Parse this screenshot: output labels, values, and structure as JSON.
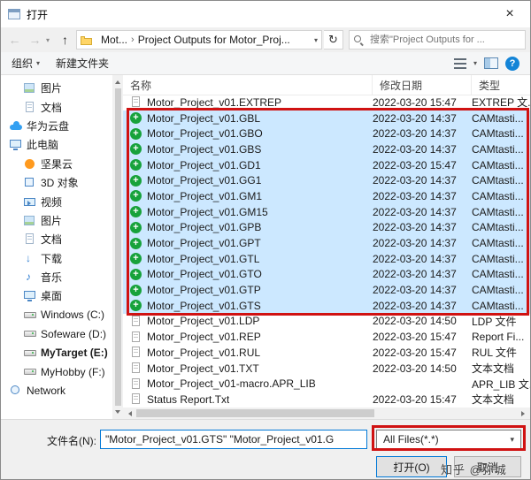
{
  "window": {
    "title": "打开"
  },
  "icons": {
    "back": "←",
    "forward": "→",
    "up": "↑",
    "refresh": "↻",
    "dropdown": "▾",
    "crumb_sep": "›",
    "close": "×",
    "help": "?"
  },
  "nav": {
    "crumb_root": "Mot...",
    "crumb_current": "Project Outputs for Motor_Proj...",
    "search_text": "搜索\"Project Outputs for ..."
  },
  "toolbar": {
    "organize": "组织",
    "new_folder": "新建文件夹"
  },
  "sidebar": {
    "items": [
      {
        "label": "图片",
        "icon": "pictures",
        "indent": 1
      },
      {
        "label": "文档",
        "icon": "documents",
        "indent": 1
      },
      {
        "label": "华为云盘",
        "icon": "cloud",
        "indent": 0
      },
      {
        "label": "此电脑",
        "icon": "computer",
        "indent": 0
      },
      {
        "label": "坚果云",
        "icon": "nutstore",
        "indent": 1
      },
      {
        "label": "3D 对象",
        "icon": "box3d",
        "indent": 1
      },
      {
        "label": "视频",
        "icon": "videos",
        "indent": 1
      },
      {
        "label": "图片",
        "icon": "pictures",
        "indent": 1
      },
      {
        "label": "文档",
        "icon": "documents",
        "indent": 1
      },
      {
        "label": "下载",
        "icon": "downloads",
        "indent": 1
      },
      {
        "label": "音乐",
        "icon": "music",
        "indent": 1
      },
      {
        "label": "桌面",
        "icon": "desktop",
        "indent": 1
      },
      {
        "label": "Windows (C:)",
        "icon": "drive",
        "indent": 1
      },
      {
        "label": "Sofeware (D:)",
        "icon": "drive",
        "indent": 1
      },
      {
        "label": "MyTarget (E:)",
        "icon": "drive",
        "indent": 1,
        "selected": true
      },
      {
        "label": "MyHobby (F:)",
        "icon": "drive",
        "indent": 1
      },
      {
        "label": "Network",
        "icon": "network",
        "indent": 0
      }
    ]
  },
  "filelist": {
    "columns": [
      "名称",
      "修改日期",
      "类型"
    ],
    "rows": [
      {
        "name": "Motor_Project_v01.EXTREP",
        "date": "2022-03-20 15:47",
        "type": "EXTREP 文...",
        "icon": "file",
        "selected": false
      },
      {
        "name": "Motor_Project_v01.GBL",
        "date": "2022-03-20 14:37",
        "type": "CAMtasti...",
        "icon": "cam",
        "selected": true
      },
      {
        "name": "Motor_Project_v01.GBO",
        "date": "2022-03-20 14:37",
        "type": "CAMtasti...",
        "icon": "cam",
        "selected": true
      },
      {
        "name": "Motor_Project_v01.GBS",
        "date": "2022-03-20 14:37",
        "type": "CAMtasti...",
        "icon": "cam",
        "selected": true
      },
      {
        "name": "Motor_Project_v01.GD1",
        "date": "2022-03-20 15:47",
        "type": "CAMtasti...",
        "icon": "cam",
        "selected": true
      },
      {
        "name": "Motor_Project_v01.GG1",
        "date": "2022-03-20 14:37",
        "type": "CAMtasti...",
        "icon": "cam",
        "selected": true
      },
      {
        "name": "Motor_Project_v01.GM1",
        "date": "2022-03-20 14:37",
        "type": "CAMtasti...",
        "icon": "cam",
        "selected": true
      },
      {
        "name": "Motor_Project_v01.GM15",
        "date": "2022-03-20 14:37",
        "type": "CAMtasti...",
        "icon": "cam",
        "selected": true
      },
      {
        "name": "Motor_Project_v01.GPB",
        "date": "2022-03-20 14:37",
        "type": "CAMtasti...",
        "icon": "cam",
        "selected": true
      },
      {
        "name": "Motor_Project_v01.GPT",
        "date": "2022-03-20 14:37",
        "type": "CAMtasti...",
        "icon": "cam",
        "selected": true
      },
      {
        "name": "Motor_Project_v01.GTL",
        "date": "2022-03-20 14:37",
        "type": "CAMtasti...",
        "icon": "cam",
        "selected": true
      },
      {
        "name": "Motor_Project_v01.GTO",
        "date": "2022-03-20 14:37",
        "type": "CAMtasti...",
        "icon": "cam",
        "selected": true
      },
      {
        "name": "Motor_Project_v01.GTP",
        "date": "2022-03-20 14:37",
        "type": "CAMtasti...",
        "icon": "cam",
        "selected": true
      },
      {
        "name": "Motor_Project_v01.GTS",
        "date": "2022-03-20 14:37",
        "type": "CAMtasti...",
        "icon": "cam",
        "selected": true
      },
      {
        "name": "Motor_Project_v01.LDP",
        "date": "2022-03-20 14:50",
        "type": "LDP 文件",
        "icon": "file",
        "selected": false
      },
      {
        "name": "Motor_Project_v01.REP",
        "date": "2022-03-20 15:47",
        "type": "Report Fi...",
        "icon": "file",
        "selected": false
      },
      {
        "name": "Motor_Project_v01.RUL",
        "date": "2022-03-20 15:47",
        "type": "RUL 文件",
        "icon": "file",
        "selected": false
      },
      {
        "name": "Motor_Project_v01.TXT",
        "date": "2022-03-20 14:50",
        "type": "文本文档",
        "icon": "file",
        "selected": false
      },
      {
        "name": "Motor_Project_v01-macro.APR_LIB",
        "date": "",
        "type": "APR_LIB 文...",
        "icon": "file",
        "selected": false
      },
      {
        "name": "Status Report.Txt",
        "date": "2022-03-20 15:47",
        "type": "文本文档",
        "icon": "file",
        "selected": false
      }
    ]
  },
  "footer": {
    "filename_label": "文件名(N):",
    "filename_value": "\"Motor_Project_v01.GTS\" \"Motor_Project_v01.G",
    "filetype_value": "All Files(*.*)",
    "open_label": "打开(O)",
    "cancel_label": "取消"
  },
  "watermark": "知乎 @弥城",
  "colors": {
    "selection": "#cce8ff",
    "annotation": "#d01212",
    "accent": "#0078d7"
  }
}
